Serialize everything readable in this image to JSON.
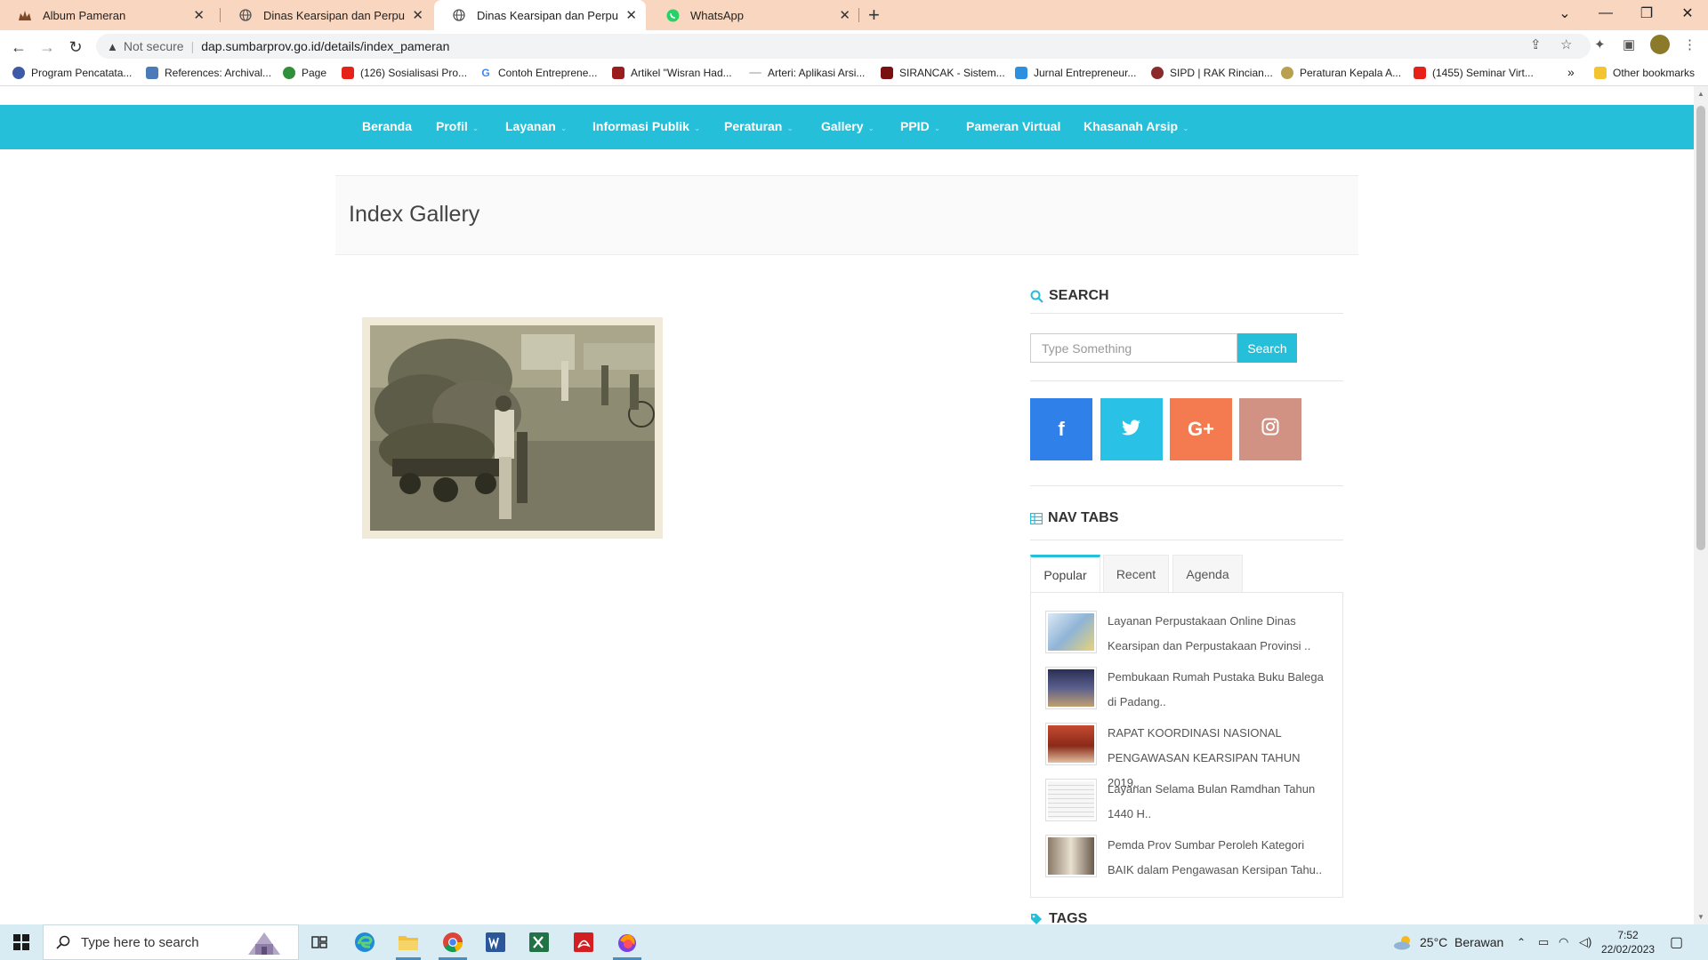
{
  "browser": {
    "tabs": [
      {
        "title": "Album Pameran",
        "active": false
      },
      {
        "title": "Dinas Kearsipan dan Perpustakaan",
        "active": false
      },
      {
        "title": "Dinas Kearsipan dan Perpustakaan",
        "active": true
      },
      {
        "title": "WhatsApp",
        "active": false
      }
    ],
    "not_secure": "Not secure",
    "url": "dap.sumbarprov.go.id/details/index_pameran",
    "bookmarks": [
      "Program Pencatata...",
      "References: Archival...",
      "Page",
      "(126) Sosialisasi Pro...",
      "Contoh Entreprene...",
      "Artikel \"Wisran Had...",
      "Arteri: Aplikasi Arsi...",
      "SIRANCAK - Sistem...",
      "Jurnal Entrepreneur...",
      "SIPD | RAK Rincian...",
      "Peraturan Kepala A...",
      "(1455) Seminar Virt..."
    ],
    "bookmarks_more": "»",
    "other_bookmarks": "Other bookmarks"
  },
  "site_nav": {
    "items": [
      {
        "label": "Beranda",
        "dropdown": false
      },
      {
        "label": "Profil",
        "dropdown": true
      },
      {
        "label": "Layanan",
        "dropdown": true
      },
      {
        "label": "Informasi Publik",
        "dropdown": true
      },
      {
        "label": "Peraturan",
        "dropdown": true
      },
      {
        "label": "Gallery",
        "dropdown": true
      },
      {
        "label": "PPID",
        "dropdown": true
      },
      {
        "label": "Pameran Virtual",
        "dropdown": false
      },
      {
        "label": "Khasanah Arsip",
        "dropdown": true
      }
    ],
    "caret": "⌄"
  },
  "page": {
    "title": "Index Gallery"
  },
  "sidebar": {
    "search": {
      "title": "SEARCH",
      "placeholder": "Type Something",
      "button": "Search"
    },
    "social": [
      {
        "name": "facebook",
        "glyph": "f",
        "color": "#2f80e8"
      },
      {
        "name": "twitter",
        "glyph": "🐦",
        "color": "#29c2e6"
      },
      {
        "name": "google-plus",
        "glyph": "G+",
        "color": "#f47b4f"
      },
      {
        "name": "instagram",
        "glyph": "◎",
        "color": "#d29283"
      }
    ],
    "nav_tabs": {
      "title": "NAV TABS",
      "tabs": [
        "Popular",
        "Recent",
        "Agenda"
      ],
      "active": "Popular",
      "posts": [
        {
          "text": "Layanan Perpustakaan Online Dinas Kearsipan dan Perpustakaan Provinsi ..",
          "thumb_color": "#8fb4d6"
        },
        {
          "text": "Pembukaan Rumah Pustaka Buku Balega di Padang..",
          "thumb_color": "#3a3f6b"
        },
        {
          "text": "RAPAT KOORDINASI NASIONAL PENGAWASAN KEARSIPAN TAHUN 2019..",
          "thumb_color": "#b0402c"
        },
        {
          "text": "Layanan Selama Bulan Ramdhan Tahun 1440 H..",
          "thumb_color": "#eeeeee"
        },
        {
          "text": "Pemda Prov Sumbar Peroleh Kategori BAIK dalam Pengawasan Kersipan Tahu..",
          "thumb_color": "#7a6a5a"
        }
      ]
    },
    "tags_title": "TAGS"
  },
  "taskbar": {
    "search_placeholder": "Type here to search",
    "weather": "25°C  Berawan",
    "time": "7:52",
    "date": "22/02/2023"
  },
  "colors": {
    "accent": "#25bfda",
    "tabstrip": "#f9d6bf"
  }
}
